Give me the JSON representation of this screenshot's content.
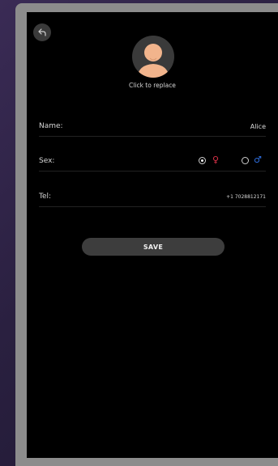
{
  "profile": {
    "avatar_caption": "Click to replace"
  },
  "form": {
    "name_label": "Name:",
    "name_value": "Alice",
    "sex_label": "Sex:",
    "sex_selected": "female",
    "tel_label": "Tel:",
    "tel_value": "+1 7028812171"
  },
  "actions": {
    "save_label": "SAVE"
  },
  "icons": {
    "back": "back-arrow-icon",
    "female": "female-symbol-icon",
    "male": "male-symbol-icon"
  },
  "colors": {
    "female_icon": "#e0324a",
    "male_icon": "#2f6fe0",
    "screen_background": "#000000",
    "button_background": "#3d3d3d"
  }
}
